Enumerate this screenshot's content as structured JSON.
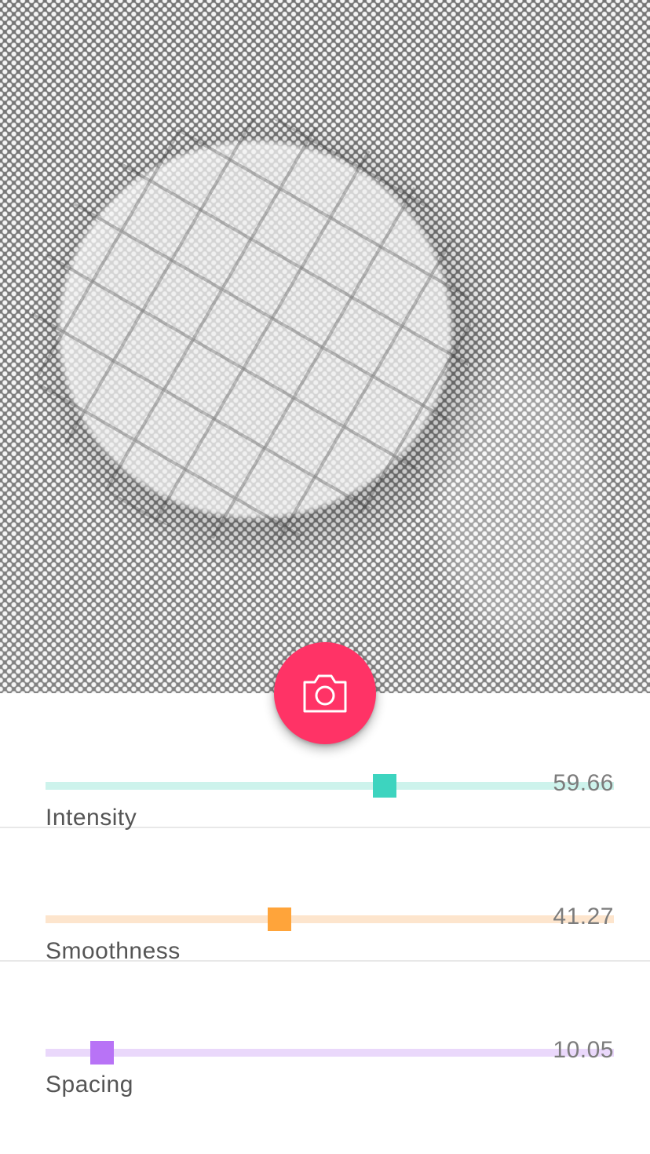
{
  "preview": {
    "image_description_icon": "halftone-preview"
  },
  "capture_button": {
    "icon": "camera-icon",
    "color": "#ff3366"
  },
  "sliders": [
    {
      "name": "Intensity",
      "value": "59.66",
      "fraction": 0.596,
      "track_color": "#cdf3ec",
      "thumb_color": "#3dd4bf"
    },
    {
      "name": "Smoothness",
      "value": "41.27",
      "fraction": 0.412,
      "track_color": "#fde5cd",
      "thumb_color": "#ffa43a"
    },
    {
      "name": "Spacing",
      "value": "10.05",
      "fraction": 0.1,
      "track_color": "#ead8fb",
      "thumb_color": "#b873f6"
    }
  ]
}
